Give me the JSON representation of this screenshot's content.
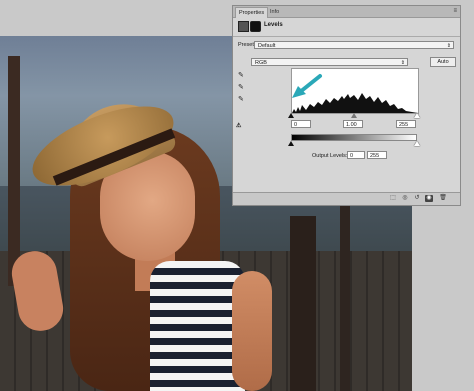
{
  "panel": {
    "tabs": [
      {
        "label": "Properties"
      },
      {
        "label": "Info"
      }
    ],
    "menu_icon": "panel-menu-icon",
    "adjustment_title": "Levels",
    "preset_label": "Preset:",
    "preset_value": "Default",
    "channel_value": "RGB",
    "auto_label": "Auto",
    "input_levels": {
      "black": "0",
      "gamma": "1.00",
      "white": "255"
    },
    "output_label": "Output Levels:",
    "output_levels": {
      "black": "0",
      "white": "255"
    },
    "eyedroppers": [
      "black-point-eyedropper-icon",
      "gray-point-eyedropper-icon",
      "white-point-eyedropper-icon"
    ],
    "footer_icons": [
      "clip-to-layer-icon",
      "view-previous-icon",
      "reset-icon",
      "visibility-icon",
      "delete-icon"
    ]
  },
  "annotation": {
    "arrow_color": "#2aa8b8"
  }
}
